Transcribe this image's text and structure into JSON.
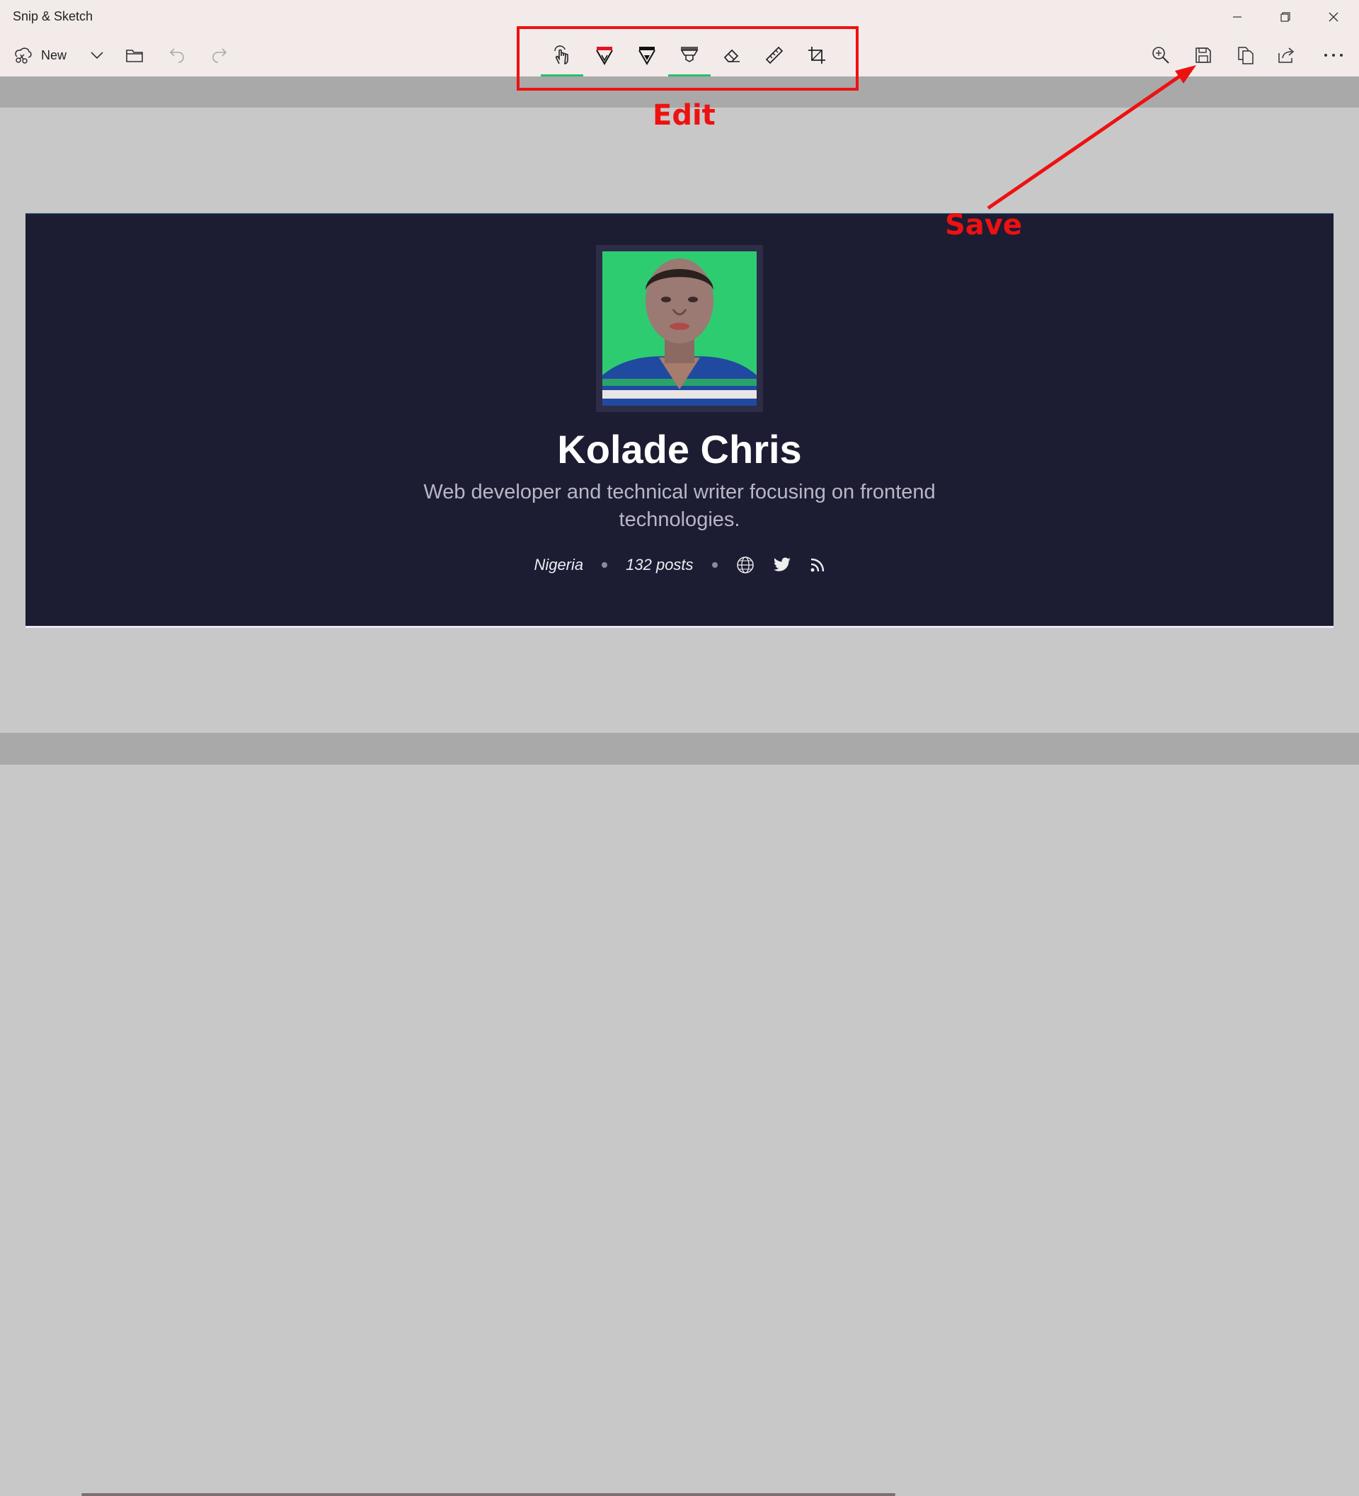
{
  "window": {
    "title": "Snip & Sketch"
  },
  "toolbar": {
    "new_label": "New",
    "left_icons": [
      "new-snip-icon",
      "chevron-down-icon",
      "folder-icon",
      "undo-icon",
      "redo-icon"
    ],
    "edit_tools": [
      "touch-writing-icon",
      "ballpoint-pen-icon",
      "pencil-icon",
      "highlighter-icon",
      "eraser-icon",
      "ruler-icon",
      "crop-icon"
    ],
    "pen_colors": {
      "ballpoint": "#e81123",
      "pencil": "#111111",
      "highlighter": "#555555"
    },
    "active_indicator_color": "#2bbd6e",
    "right_icons": [
      "zoom-icon",
      "save-icon",
      "copy-icon",
      "share-icon",
      "more-icon"
    ]
  },
  "annotations": {
    "edit_label": "Edit",
    "save_label": "Save",
    "color": "#ee1111"
  },
  "profile": {
    "name": "Kolade Chris",
    "bio": "Web developer and technical writer focusing on frontend technologies.",
    "location": "Nigeria",
    "posts": "132 posts",
    "avatar_bg": "#2ecc71",
    "card_bg": "#1c1d33"
  }
}
